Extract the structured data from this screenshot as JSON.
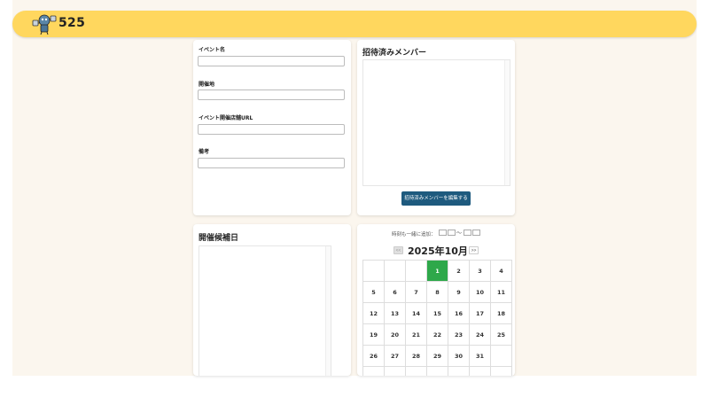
{
  "header": {
    "brand": "525"
  },
  "form": {
    "event_name_label": "イベント名",
    "venue_label": "開催地",
    "venue_url_label": "イベント開催店舗URL",
    "notes_label": "備考",
    "event_name_value": "",
    "venue_value": "",
    "venue_url_value": "",
    "notes_value": ""
  },
  "members": {
    "title": "招待済みメンバー",
    "edit_button": "招待済みメンバーを編集する"
  },
  "candidate_dates": {
    "title": "開催候補日"
  },
  "calendar": {
    "time_add_label": "時刻も一緒に追加：",
    "time_separator": "〜",
    "prev_label": "<<",
    "next_label": ">>",
    "month_title": "2025年10月",
    "selected_day": "1",
    "days": [
      "",
      "",
      "",
      "1",
      "2",
      "3",
      "4",
      "5",
      "6",
      "7",
      "8",
      "9",
      "10",
      "11",
      "12",
      "13",
      "14",
      "15",
      "16",
      "17",
      "18",
      "19",
      "20",
      "21",
      "22",
      "23",
      "24",
      "25",
      "26",
      "27",
      "28",
      "29",
      "30",
      "31",
      "",
      "",
      "",
      "",
      "",
      "",
      "",
      ""
    ]
  },
  "colors": {
    "header_bg": "#ffd75e",
    "page_bg": "#fbf6ee",
    "primary_button": "#1e5a7e",
    "selected_day": "#2ea84a"
  }
}
